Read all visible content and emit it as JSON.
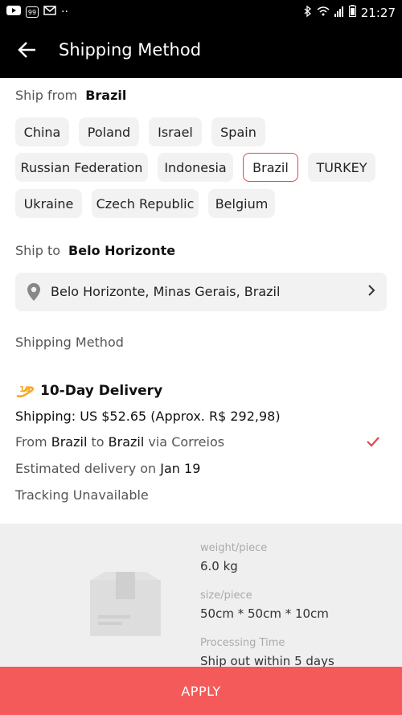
{
  "status_bar": {
    "time": "21:27",
    "notif_box_text": "99"
  },
  "header": {
    "title": "Shipping Method"
  },
  "ship_from": {
    "label": "Ship from",
    "selected": "Brazil",
    "options": [
      "China",
      "Poland",
      "Israel",
      "Spain",
      "Russian Federation",
      "Indonesia",
      "Brazil",
      "TURKEY",
      "Ukraine",
      "Czech Republic",
      "Belgium"
    ]
  },
  "ship_to": {
    "label": "Ship to",
    "value": "Belo Horizonte",
    "address": "Belo Horizonte, Minas Gerais, Brazil"
  },
  "shipping_method": {
    "label": "Shipping Method",
    "option": {
      "name": "10-Day Delivery",
      "shipping_prefix": "Shipping:",
      "shipping_cost": "US $52.65 (Approx. R$ 292,98)",
      "route_prefix": "From",
      "route_from": "Brazil",
      "route_mid": "to",
      "route_to": "Brazil",
      "route_suffix": "via Correios",
      "estimated_prefix": "Estimated delivery on",
      "estimated_date": "Jan 19",
      "tracking": "Tracking Unavailable"
    }
  },
  "package_info": {
    "weight_label": "weight/piece",
    "weight_value": "6.0 kg",
    "size_label": "size/piece",
    "size_value": "50cm * 50cm * 10cm",
    "processing_label": "Processing Time",
    "processing_value": "Ship out within 5 days"
  },
  "apply_button": {
    "label": "APPLY"
  },
  "colors": {
    "accent": "#e0474c",
    "apply_bg": "#f45a5a",
    "check": "#e0474c",
    "appbar_bg": "#000000"
  }
}
